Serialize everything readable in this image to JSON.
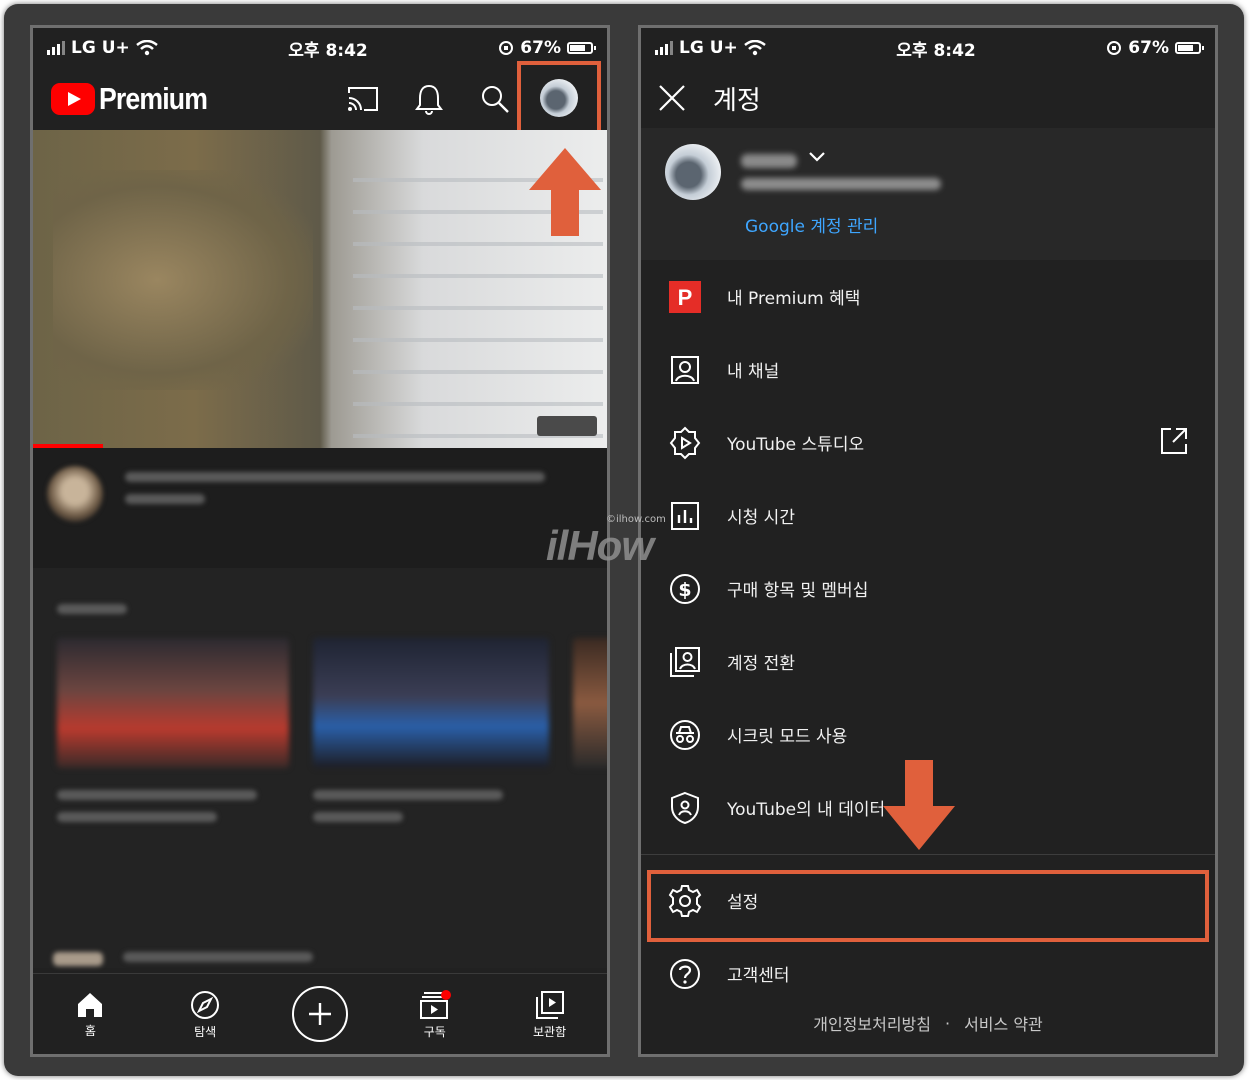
{
  "status": {
    "carrier": "LG U+",
    "time": "오후 8:42",
    "battery": "67%"
  },
  "left": {
    "logo_text": "Premium",
    "header_icons": [
      "cast-icon",
      "bell-icon",
      "search-icon",
      "avatar"
    ],
    "nav": [
      {
        "label": "홈",
        "icon": "home-icon"
      },
      {
        "label": "탐색",
        "icon": "explore-icon"
      },
      {
        "label": "",
        "icon": "create-icon"
      },
      {
        "label": "구독",
        "icon": "subscriptions-icon"
      },
      {
        "label": "보관함",
        "icon": "library-icon"
      }
    ]
  },
  "right": {
    "title": "계정",
    "manage_account": "Google 계정 관리",
    "menu": [
      {
        "label": "내 Premium 혜택",
        "icon": "premium-icon"
      },
      {
        "label": "내 채널",
        "icon": "channel-icon"
      },
      {
        "label": "YouTube 스튜디오",
        "icon": "studio-icon"
      },
      {
        "label": "시청 시간",
        "icon": "watch-time-icon"
      },
      {
        "label": "구매 항목 및 멤버십",
        "icon": "purchases-icon"
      },
      {
        "label": "계정 전환",
        "icon": "switch-account-icon"
      },
      {
        "label": "시크릿 모드 사용",
        "icon": "incognito-icon"
      },
      {
        "label": "YouTube의 내 데이터",
        "icon": "data-shield-icon"
      },
      {
        "label": "설정",
        "icon": "gear-icon"
      },
      {
        "label": "고객센터",
        "icon": "help-icon"
      }
    ],
    "footer_links": [
      "개인정보처리방침",
      "서비스 약관"
    ],
    "footer_separator": "·"
  },
  "watermark": {
    "small": "©ilhow.com",
    "big": "ilHow"
  },
  "colors": {
    "highlight": "#e0603c",
    "youtube_red": "#ff0000",
    "link_blue": "#3ea6ff",
    "background": "#212121"
  }
}
